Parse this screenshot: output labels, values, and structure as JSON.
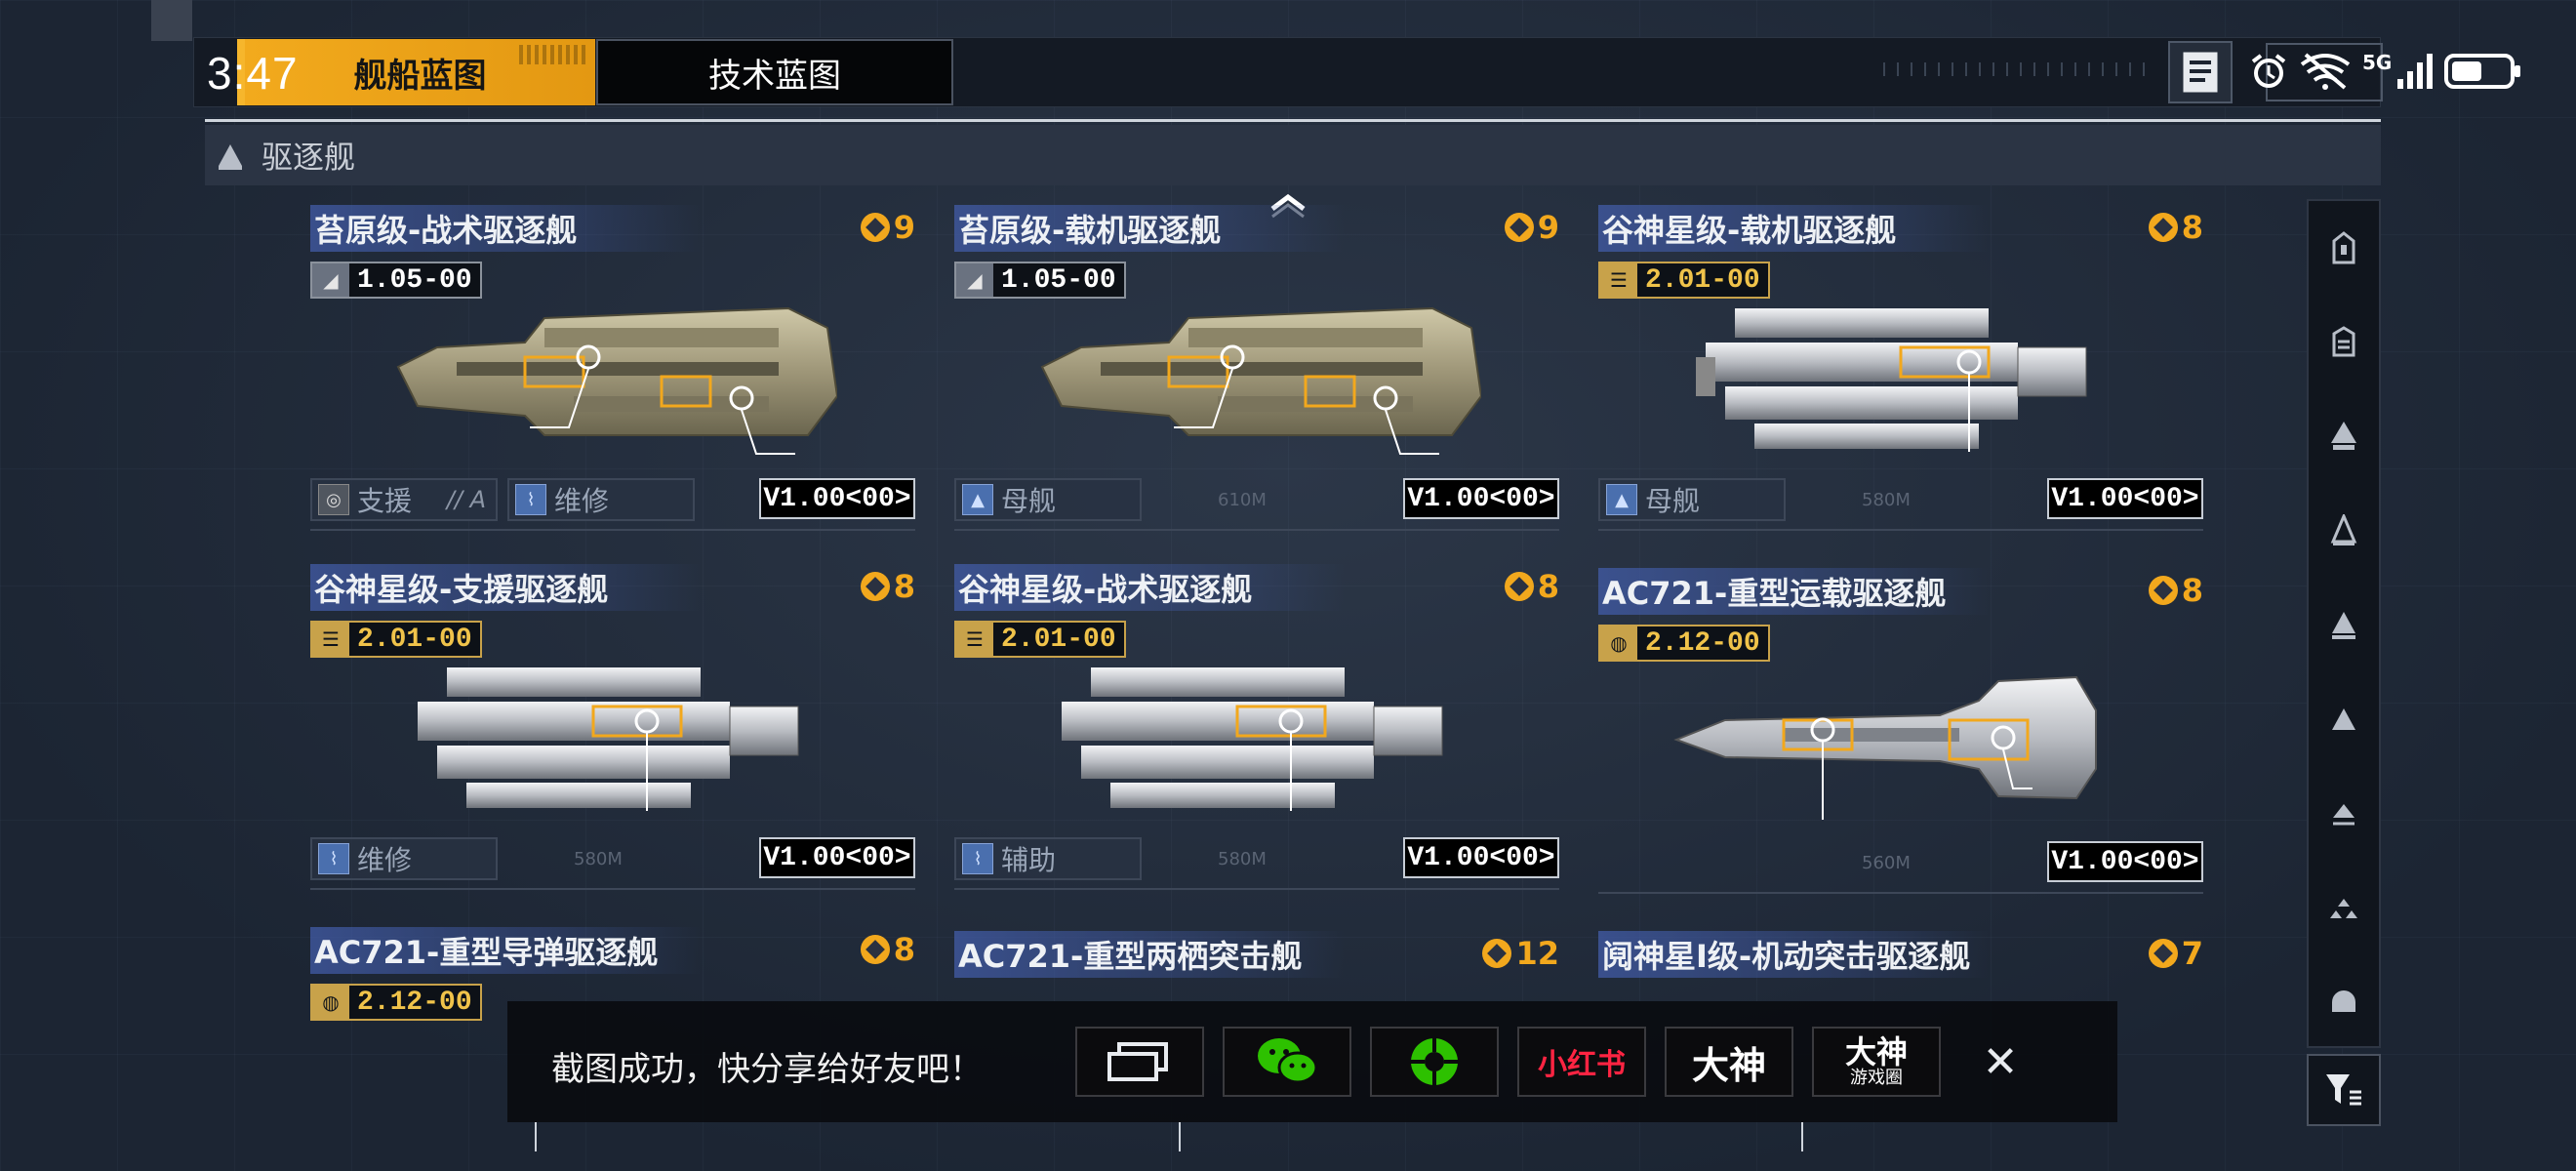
{
  "status_bar": {
    "time": "3:47",
    "network": "5G"
  },
  "tabs": [
    {
      "label": "舰船蓝图",
      "active": true
    },
    {
      "label": "技术蓝图",
      "active": false
    }
  ],
  "section": {
    "title": "驱逐舰"
  },
  "cards": [
    {
      "title": "苔原级-战术驱逐舰",
      "cost": "9",
      "version_code": "1.05",
      "version_sub": "00",
      "tags": [
        {
          "label": "支援",
          "suffix": "// A"
        },
        {
          "label": "维修"
        }
      ],
      "version": "V1.00<00>"
    },
    {
      "title": "苔原级-载机驱逐舰",
      "cost": "9",
      "version_code": "1.05",
      "version_sub": "00",
      "tags": [
        {
          "label": "母舰"
        }
      ],
      "length": "610M",
      "version": "V1.00<00>"
    },
    {
      "title": "谷神星级-载机驱逐舰",
      "cost": "8",
      "version_code": "2.01",
      "version_sub": "00",
      "tags": [
        {
          "label": "母舰"
        }
      ],
      "length": "580M",
      "version": "V1.00<00>"
    },
    {
      "title": "谷神星级-支援驱逐舰",
      "cost": "8",
      "version_code": "2.01",
      "version_sub": "00",
      "tags": [
        {
          "label": "维修"
        }
      ],
      "length": "580M",
      "version": "V1.00<00>"
    },
    {
      "title": "谷神星级-战术驱逐舰",
      "cost": "8",
      "version_code": "2.01",
      "version_sub": "00",
      "tags": [
        {
          "label": "辅助"
        }
      ],
      "length": "580M",
      "version": "V1.00<00>"
    },
    {
      "title": "AC721-重型运载驱逐舰",
      "cost": "8",
      "version_code": "2.12",
      "version_sub": "00",
      "tags": [],
      "length": "560M",
      "version": "V1.00<00>"
    },
    {
      "title": "AC721-重型导弹驱逐舰",
      "cost": "8",
      "version_code": "2.12",
      "version_sub": "00"
    },
    {
      "title": "AC721-重型两栖突击舰",
      "cost": "12"
    },
    {
      "title": "阋神星I级-机动突击驱逐舰",
      "cost": "7"
    }
  ],
  "share_bar": {
    "message": "截图成功，快分享给好友吧！",
    "buttons": [
      {
        "name": "screenshot",
        "label": ""
      },
      {
        "name": "wechat",
        "label": ""
      },
      {
        "name": "moments",
        "label": ""
      },
      {
        "name": "xiaohongshu",
        "label": "小红书"
      },
      {
        "name": "dashen",
        "label": "大神"
      },
      {
        "name": "dashen-circle",
        "label": "大神",
        "sub": "游戏圈"
      }
    ],
    "close": "✕"
  },
  "colors": {
    "accent": "#f2a81d",
    "tag_blue": "#4a6fae",
    "title_band": "#425ca8"
  }
}
